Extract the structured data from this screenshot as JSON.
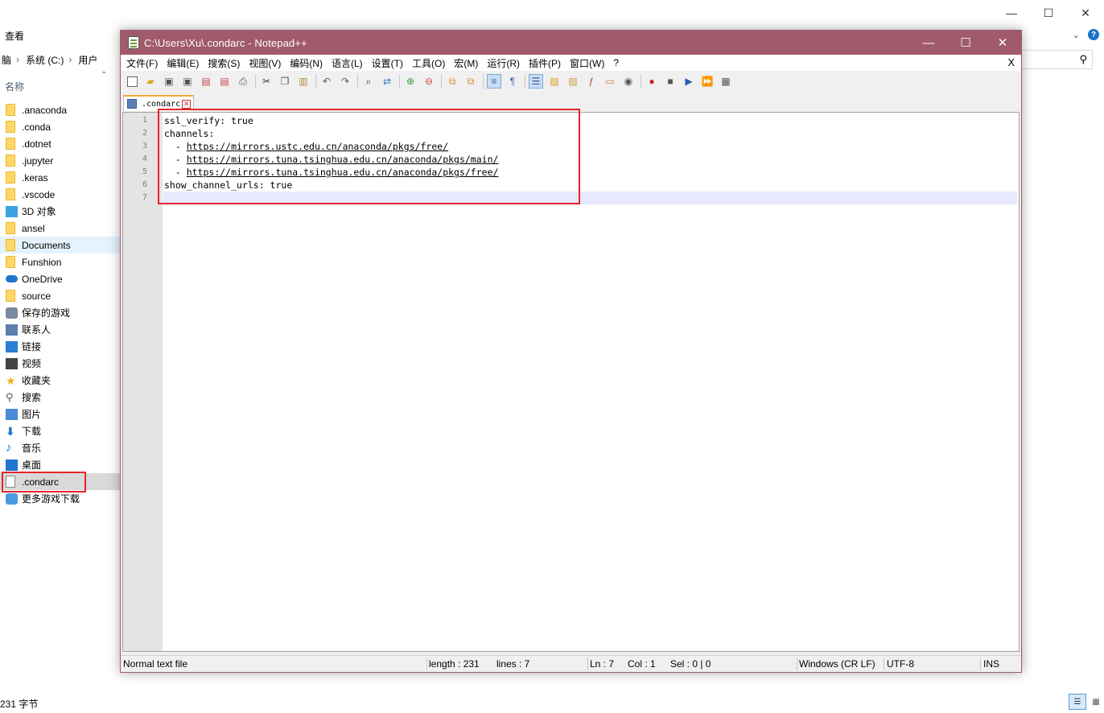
{
  "explorer": {
    "ribbon_label": "查看",
    "breadcrumb": {
      "partial": "脑",
      "drive": "系统 (C:)",
      "users": "用户"
    },
    "column_header": "名称",
    "items": [
      {
        "label": ".anaconda",
        "icon": "folder-icon"
      },
      {
        "label": ".conda",
        "icon": "folder-icon"
      },
      {
        "label": ".dotnet",
        "icon": "folder-icon"
      },
      {
        "label": ".jupyter",
        "icon": "folder-icon"
      },
      {
        "label": ".keras",
        "icon": "folder-icon"
      },
      {
        "label": ".vscode",
        "icon": "folder-icon"
      },
      {
        "label": "3D 对象",
        "icon": "3d-objects-icon"
      },
      {
        "label": "ansel",
        "icon": "folder-icon"
      },
      {
        "label": "Documents",
        "icon": "folder-icon"
      },
      {
        "label": "Funshion",
        "icon": "folder-icon"
      },
      {
        "label": "OneDrive",
        "icon": "onedrive-icon"
      },
      {
        "label": "source",
        "icon": "folder-icon"
      },
      {
        "label": "保存的游戏",
        "icon": "saved-games-icon"
      },
      {
        "label": "联系人",
        "icon": "contacts-icon"
      },
      {
        "label": "链接",
        "icon": "links-icon"
      },
      {
        "label": "视频",
        "icon": "videos-icon"
      },
      {
        "label": "收藏夹",
        "icon": "favorites-icon"
      },
      {
        "label": "搜索",
        "icon": "searches-icon"
      },
      {
        "label": "图片",
        "icon": "pictures-icon"
      },
      {
        "label": "下载",
        "icon": "downloads-icon"
      },
      {
        "label": "音乐",
        "icon": "music-icon"
      },
      {
        "label": "桌面",
        "icon": "desktop-icon"
      },
      {
        "label": ".condarc",
        "icon": "file-icon"
      },
      {
        "label": "更多游戏下载",
        "icon": "more-games-icon"
      }
    ],
    "status": "231 字节",
    "highlight_color": "#e8232b"
  },
  "notepad": {
    "title": "C:\\Users\\Xu\\.condarc - Notepad++",
    "title_bar_color": "#a05a6b",
    "menu": [
      "文件(F)",
      "编辑(E)",
      "搜索(S)",
      "视图(V)",
      "编码(N)",
      "语言(L)",
      "设置(T)",
      "工具(O)",
      "宏(M)",
      "运行(R)",
      "插件(P)",
      "窗口(W)",
      "?"
    ],
    "menu_close": "X",
    "tab_label": ".condarc",
    "line_numbers": [
      "1",
      "2",
      "3",
      "4",
      "5",
      "6",
      "7"
    ],
    "lines": {
      "l1": "ssl_verify: true",
      "l2": "channels:",
      "l3_prefix": "  - ",
      "l3_url": "https://mirrors.ustc.edu.cn/anaconda/pkgs/free/",
      "l4_prefix": "  - ",
      "l4_url": "https://mirrors.tuna.tsinghua.edu.cn/anaconda/pkgs/main/",
      "l5_prefix": "  - ",
      "l5_url": "https://mirrors.tuna.tsinghua.edu.cn/anaconda/pkgs/free/",
      "l6": "show_channel_urls: true",
      "l7": ""
    },
    "status": {
      "filetype": "Normal text file",
      "length": "length : 231",
      "lines": "lines : 7",
      "ln": "Ln : 7",
      "col": "Col : 1",
      "sel": "Sel : 0 | 0",
      "eol": "Windows (CR LF)",
      "encoding": "UTF-8",
      "mode": "INS"
    }
  }
}
